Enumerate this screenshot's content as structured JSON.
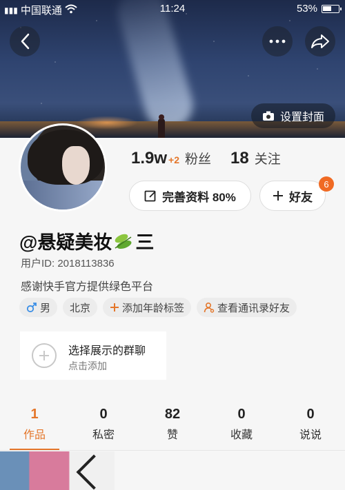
{
  "status_bar": {
    "carrier": "中国联通",
    "time": "11:24",
    "battery": "53%"
  },
  "cover": {
    "set_cover_label": "设置封面"
  },
  "stats": {
    "followers_count": "1.9w",
    "followers_delta": "+2",
    "followers_label": "粉丝",
    "following_count": "18",
    "following_label": "关注"
  },
  "actions": {
    "edit_profile_label": "完善资料 80%",
    "add_friend_label": "好友",
    "friend_badge": "6"
  },
  "profile": {
    "name_prefix": "@悬疑美妆",
    "name_suffix": "三",
    "user_id": "用户ID: 2018113836",
    "bio": "感谢快手官方提供绿色平台"
  },
  "tags": [
    {
      "label": "男",
      "icon": "male-icon"
    },
    {
      "label": "北京"
    },
    {
      "label": "添加年龄标签",
      "icon": "plus-icon"
    },
    {
      "label": "查看通讯录好友",
      "icon": "contacts-icon"
    }
  ],
  "group_card": {
    "title": "选择展示的群聊",
    "subtitle": "点击添加"
  },
  "tabs": [
    {
      "count": "1",
      "label": "作品",
      "active": true
    },
    {
      "count": "0",
      "label": "私密"
    },
    {
      "count": "82",
      "label": "赞"
    },
    {
      "count": "0",
      "label": "收藏"
    },
    {
      "count": "0",
      "label": "说说"
    }
  ],
  "colors": {
    "accent": "#e4762a",
    "badge": "#f06a23"
  }
}
